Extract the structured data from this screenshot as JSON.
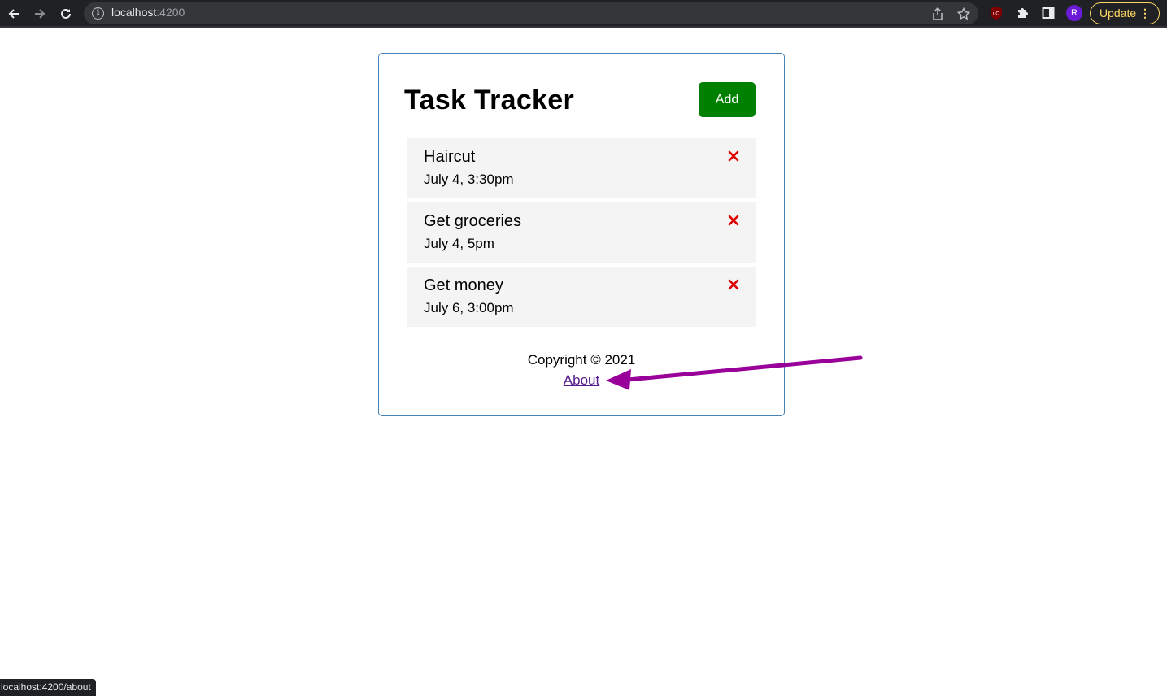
{
  "browser": {
    "url_host": "localhost",
    "url_port": ":4200",
    "update_label": "Update",
    "profile_initial": "R",
    "status_url": "localhost:4200/about"
  },
  "app": {
    "title": "Task Tracker",
    "add_label": "Add",
    "tasks": [
      {
        "text": "Haircut",
        "day": "July 4, 3:30pm"
      },
      {
        "text": "Get groceries",
        "day": "July 4, 5pm"
      },
      {
        "text": "Get money",
        "day": "July 6, 3:00pm"
      }
    ],
    "footer": {
      "copyright": "Copyright © 2021",
      "about_label": "About"
    }
  },
  "colors": {
    "add_button": "#008000",
    "delete_icon": "#e00000",
    "container_border": "#4682b4",
    "annotation_arrow": "#990099",
    "link": "#551a8b"
  },
  "icons": {
    "back": "arrow-left-icon",
    "forward": "arrow-right-icon",
    "reload": "reload-icon",
    "info": "info-icon",
    "share": "share-icon",
    "bookmark": "star-icon",
    "ublock": "ublock-icon",
    "extensions": "puzzle-icon",
    "sidepanel": "sidepanel-icon",
    "delete": "times-icon"
  }
}
